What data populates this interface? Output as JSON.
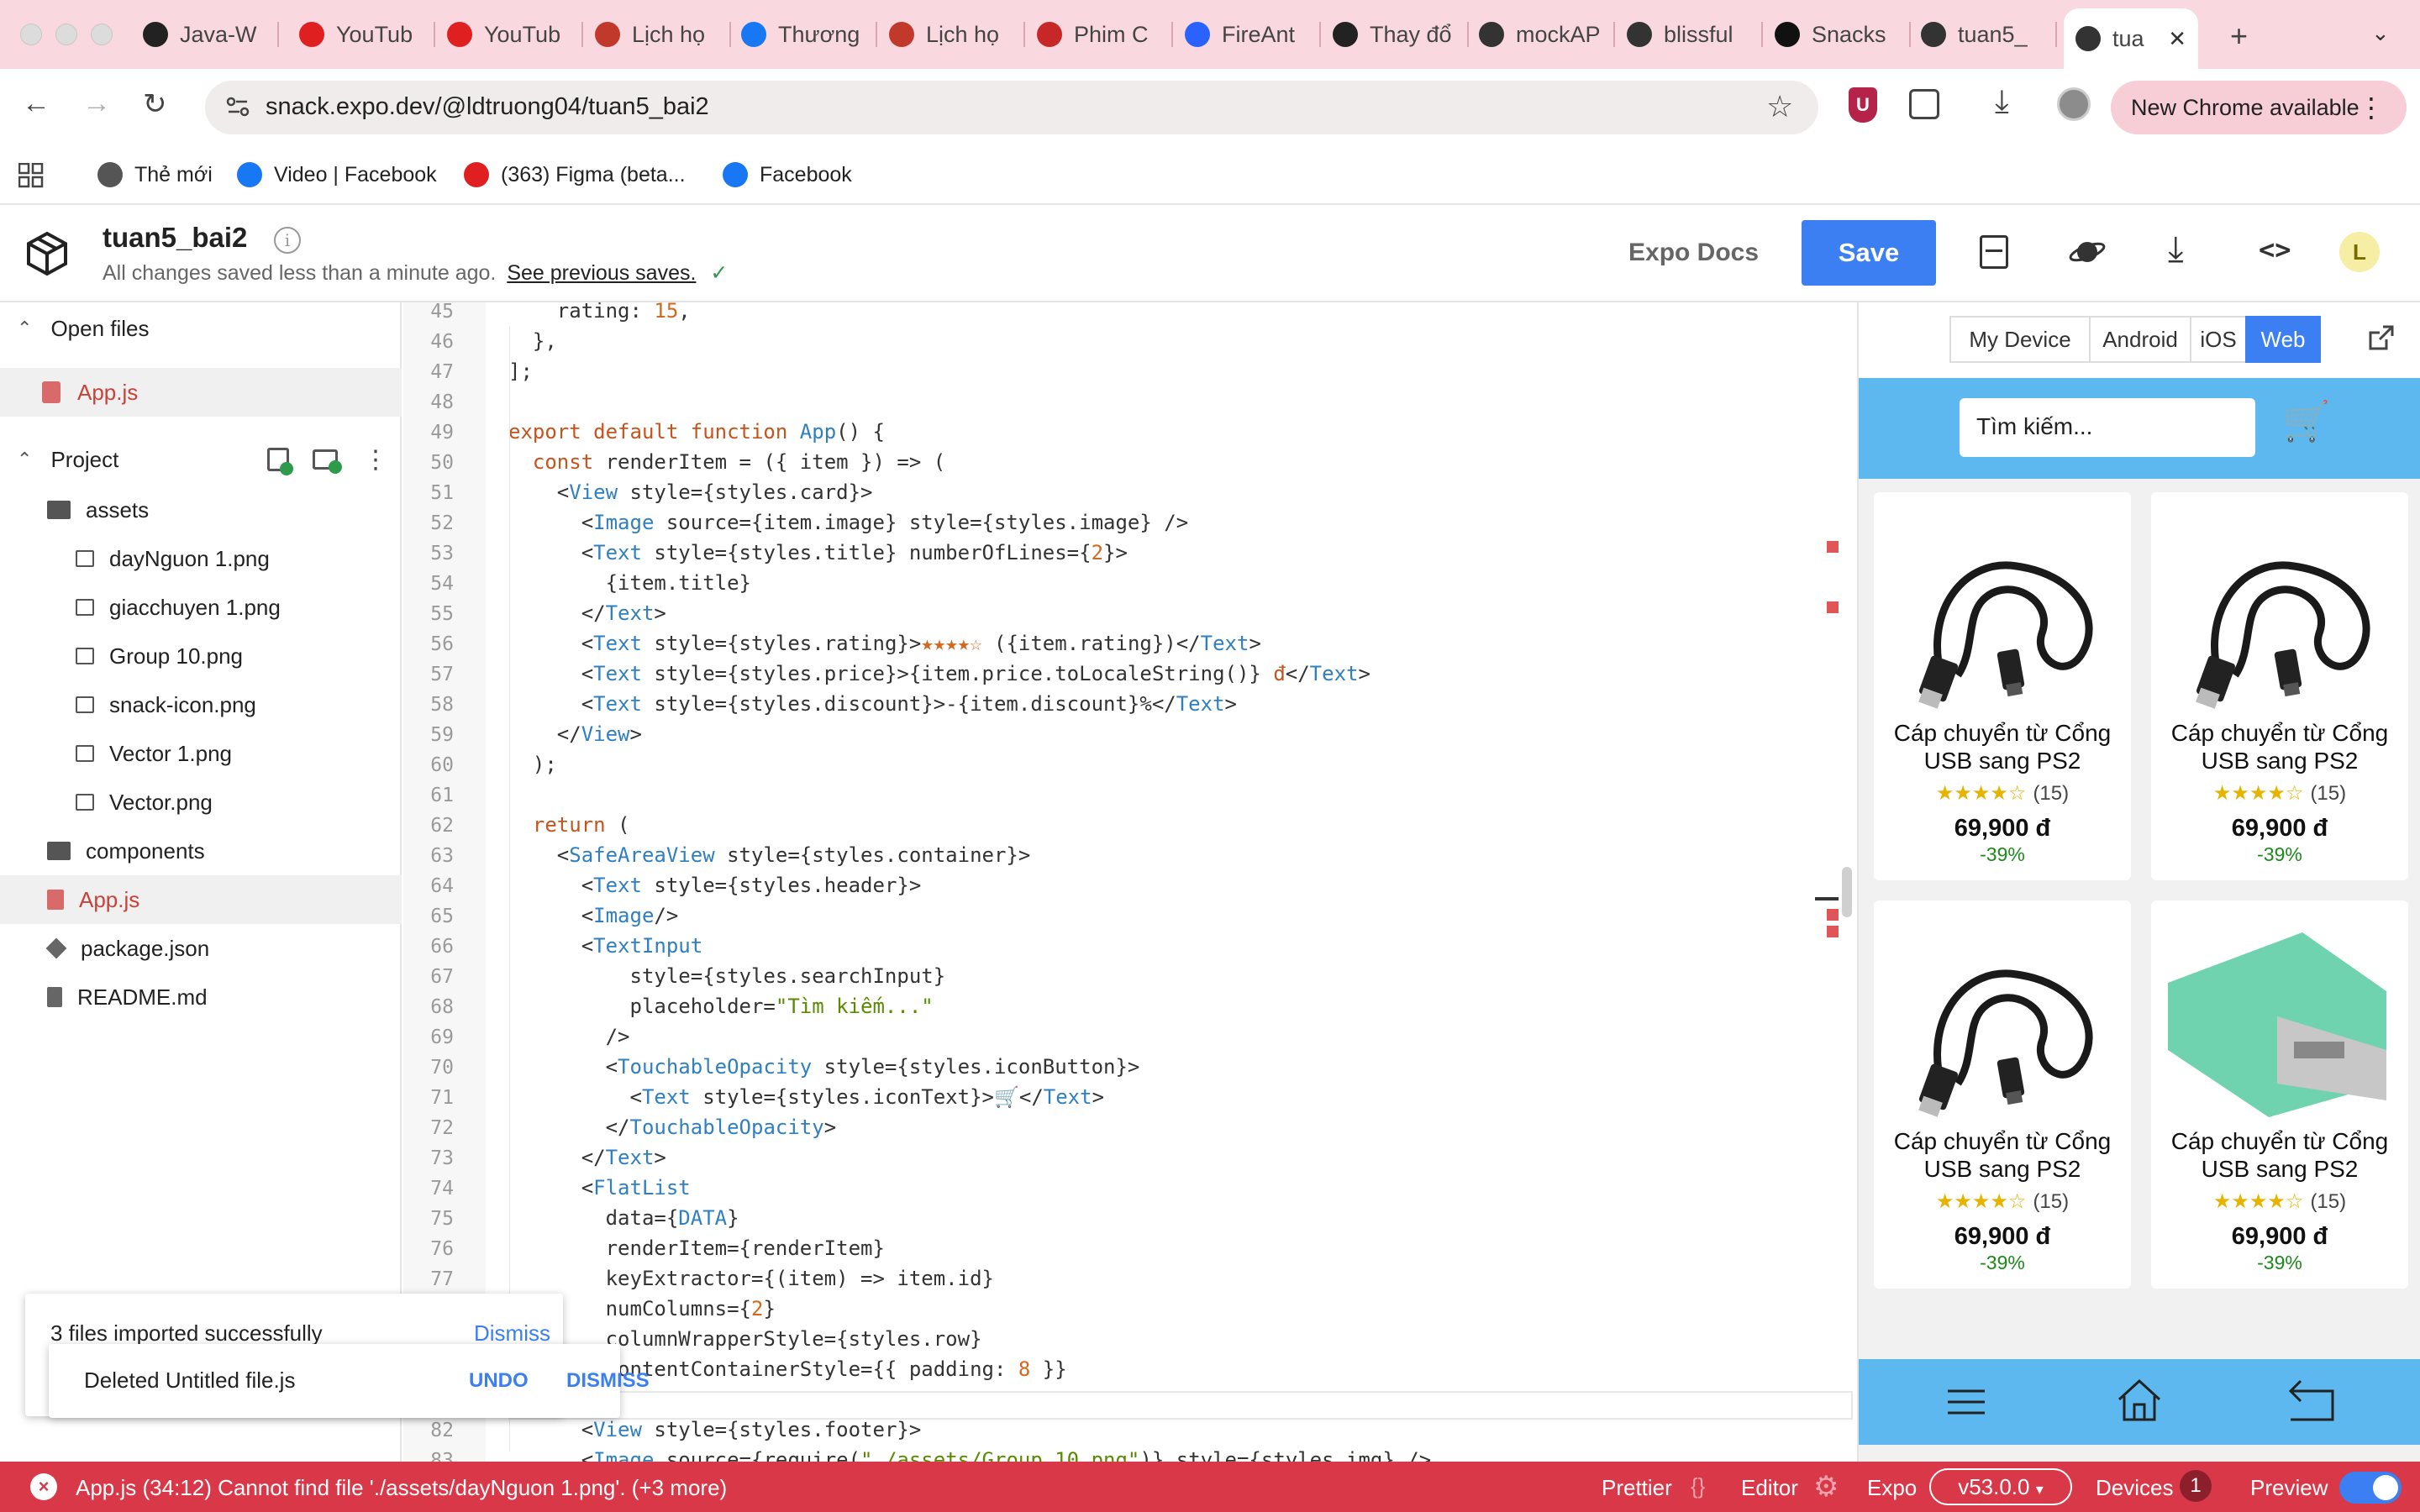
{
  "browser": {
    "tabs": [
      {
        "label": "Java-W",
        "icon": "github-icon",
        "color": "#222222"
      },
      {
        "label": "YouTub",
        "icon": "youtube-icon",
        "color": "#e02020"
      },
      {
        "label": "YouTub",
        "icon": "youtube-icon",
        "color": "#e02020"
      },
      {
        "label": "Lịch họ",
        "icon": "school-icon",
        "color": "#c0392b"
      },
      {
        "label": "Thương",
        "icon": "facebook-icon",
        "color": "#1877f2"
      },
      {
        "label": "Lịch họ",
        "icon": "school-icon",
        "color": "#c0392b"
      },
      {
        "label": "Phim C",
        "icon": "play-icon",
        "color": "#c62828"
      },
      {
        "label": "FireAnt",
        "icon": "fireant-icon",
        "color": "#2962ff"
      },
      {
        "label": "Thay đổ",
        "icon": "openai-icon",
        "color": "#222222"
      },
      {
        "label": "mockAP",
        "icon": "mockapi-icon",
        "color": "#333333"
      },
      {
        "label": "blissful",
        "icon": "snack-icon",
        "color": "#333333"
      },
      {
        "label": "Snacks",
        "icon": "expo-icon",
        "color": "#111111"
      },
      {
        "label": "tuan5_",
        "icon": "snack-icon",
        "color": "#333333"
      },
      {
        "label": "tua",
        "icon": "snack-icon",
        "color": "#333333"
      }
    ],
    "url": "snack.expo.dev/@ldtruong04/tuan5_bai2",
    "ublock_badge": "U",
    "new_chrome": "New Chrome available",
    "bookmarks": [
      {
        "label": "Thẻ mới",
        "icon": "globe-icon",
        "color": "#555555"
      },
      {
        "label": "Video | Facebook",
        "icon": "facebook-icon",
        "color": "#1877f2"
      },
      {
        "label": "(363) Figma (beta...",
        "icon": "youtube-icon",
        "color": "#e02020"
      },
      {
        "label": "Facebook",
        "icon": "facebook-icon",
        "color": "#1877f2"
      }
    ]
  },
  "snack": {
    "project_name": "tuan5_bai2",
    "save_status": "All changes saved less than a minute ago.",
    "see_saves": "See previous saves.",
    "docs": "Expo Docs",
    "save": "Save",
    "avatar": "L"
  },
  "sidebar": {
    "open_files": "Open files",
    "open_file": "App.js",
    "project": "Project",
    "tree": [
      {
        "label": "assets",
        "kind": "folder",
        "indent": 0
      },
      {
        "label": "dayNguon 1.png",
        "kind": "image",
        "indent": 1
      },
      {
        "label": "giacchuyen 1.png",
        "kind": "image",
        "indent": 1
      },
      {
        "label": "Group 10.png",
        "kind": "image",
        "indent": 1
      },
      {
        "label": "snack-icon.png",
        "kind": "image",
        "indent": 1
      },
      {
        "label": "Vector 1.png",
        "kind": "image",
        "indent": 1
      },
      {
        "label": "Vector.png",
        "kind": "image",
        "indent": 1
      },
      {
        "label": "components",
        "kind": "folder",
        "indent": 0
      },
      {
        "label": "App.js",
        "kind": "js",
        "indent": 0
      },
      {
        "label": "package.json",
        "kind": "pkg",
        "indent": 0
      },
      {
        "label": "README.md",
        "kind": "doc",
        "indent": 0
      }
    ]
  },
  "toasts": {
    "imported": "3 files imported successfully",
    "dismiss": "Dismiss",
    "deleted": "Deleted Untitled file.js",
    "undo": "UNDO",
    "dismiss2": "DISMISS"
  },
  "code": {
    "lines": [
      {
        "n": "45",
        "html": "    <span class='p'>rating: </span><span class='n'>15</span>,"
      },
      {
        "n": "46",
        "html": "  },"
      },
      {
        "n": "47",
        "html": "];"
      },
      {
        "n": "48",
        "html": ""
      },
      {
        "n": "49",
        "html": "<span class='k'>export default function</span> <span class='t'>App</span>() {"
      },
      {
        "n": "50",
        "html": "  <span class='k'>const</span> renderItem = ({ item }) =&gt; ("
      },
      {
        "n": "51",
        "html": "    &lt;<span class='t'>View</span> style={styles.card}&gt;"
      },
      {
        "n": "52",
        "html": "      &lt;<span class='t'>Image</span> source={item.image} style={styles.image} /&gt;"
      },
      {
        "n": "53",
        "html": "      &lt;<span class='t'>Text</span> style={styles.title} numberOfLines={<span class='n'>2</span>}&gt;"
      },
      {
        "n": "54",
        "html": "        {item.title}"
      },
      {
        "n": "55",
        "html": "      &lt;/<span class='t'>Text</span>&gt;"
      },
      {
        "n": "56",
        "html": "      &lt;<span class='t'>Text</span> style={styles.rating}&gt;<span class='n'>★★★★☆</span> ({item.rating})&lt;/<span class='t'>Text</span>&gt;"
      },
      {
        "n": "57",
        "html": "      &lt;<span class='t'>Text</span> style={styles.price}&gt;{item.price.toLocaleString()} <span class='k'>đ</span>&lt;/<span class='t'>Text</span>&gt;"
      },
      {
        "n": "58",
        "html": "      &lt;<span class='t'>Text</span> style={styles.discount}&gt;-{item.discount}%&lt;/<span class='t'>Text</span>&gt;"
      },
      {
        "n": "59",
        "html": "    &lt;/<span class='t'>View</span>&gt;"
      },
      {
        "n": "60",
        "html": "  );"
      },
      {
        "n": "61",
        "html": ""
      },
      {
        "n": "62",
        "html": "  <span class='k'>return</span> ("
      },
      {
        "n": "63",
        "html": "    &lt;<span class='t'>SafeAreaView</span> style={styles.container}&gt;"
      },
      {
        "n": "64",
        "html": "      &lt;<span class='t'>Text</span> style={styles.header}&gt;"
      },
      {
        "n": "65",
        "html": "      &lt;<span class='t'>Image</span>/&gt;"
      },
      {
        "n": "66",
        "html": "      &lt;<span class='t'>TextInput</span>"
      },
      {
        "n": "67",
        "html": "          style={styles.searchInput}"
      },
      {
        "n": "68",
        "html": "          placeholder=<span class='s'>\"Tìm kiếm...\"</span>"
      },
      {
        "n": "69",
        "html": "        /&gt;"
      },
      {
        "n": "70",
        "html": "        &lt;<span class='t'>TouchableOpacity</span> style={styles.iconButton}&gt;"
      },
      {
        "n": "71",
        "html": "          &lt;<span class='t'>Text</span> style={styles.iconText}&gt;🛒&lt;/<span class='t'>Text</span>&gt;"
      },
      {
        "n": "72",
        "html": "        &lt;/<span class='t'>TouchableOpacity</span>&gt;"
      },
      {
        "n": "73",
        "html": "      &lt;/<span class='t'>Text</span>&gt;"
      },
      {
        "n": "74",
        "html": "      &lt;<span class='t'>FlatList</span>"
      },
      {
        "n": "75",
        "html": "        data={<span class='t'>DATA</span>}"
      },
      {
        "n": "76",
        "html": "        renderItem={renderItem}"
      },
      {
        "n": "77",
        "html": "        keyExtractor={(item) =&gt; item.id}"
      },
      {
        "n": "",
        "html": "        numColumns={<span class='n'>2</span>}"
      },
      {
        "n": "",
        "html": "        columnWrapperStyle={styles.row}"
      },
      {
        "n": "",
        "html": "        contentContainerStyle={{ padding: <span class='n'>8</span> }}"
      },
      {
        "n": "",
        "html": ""
      },
      {
        "n": "82",
        "html": "      &lt;<span class='t'>View</span> style={styles.footer}&gt;"
      },
      {
        "n": "83",
        "html": "      &lt;<span class='t'>Image</span> source={require(<span class='s'>\"./assets/Group 10.png\"</span>)} style={styles.img} /&gt;"
      }
    ]
  },
  "preview": {
    "tabs": [
      "My Device",
      "Android",
      "iOS",
      "Web"
    ],
    "active_tab": "Web",
    "search_placeholder": "Tìm kiếm...",
    "products": [
      {
        "title": "Cáp chuyển từ Cổng USB sang PS2",
        "stars": "★★★★☆",
        "rating": "(15)",
        "price": "69,900 đ",
        "discount": "-39%",
        "image": "black-cable"
      },
      {
        "title": "Cáp chuyển từ Cổng USB sang PS2",
        "stars": "★★★★☆",
        "rating": "(15)",
        "price": "69,900 đ",
        "discount": "-39%",
        "image": "black-cable"
      },
      {
        "title": "Cáp chuyển từ Cổng USB sang PS2",
        "stars": "★★★★☆",
        "rating": "(15)",
        "price": "69,900 đ",
        "discount": "-39%",
        "image": "black-cable"
      },
      {
        "title": "Cáp chuyển từ Cổng USB sang PS2",
        "stars": "★★★★☆",
        "rating": "(15)",
        "price": "69,900 đ",
        "discount": "-39%",
        "image": "green-adapter"
      }
    ],
    "accent": "#5eb8f0"
  },
  "status": {
    "error": "App.js (34:12) Cannot find file './assets/dayNguon 1.png'. (+3 more)",
    "prettier": "Prettier",
    "prettier_icon": "{}",
    "editor": "Editor",
    "expo": "Expo",
    "version": "v53.0.0",
    "devices": "Devices",
    "devices_count": "1",
    "preview": "Preview"
  }
}
